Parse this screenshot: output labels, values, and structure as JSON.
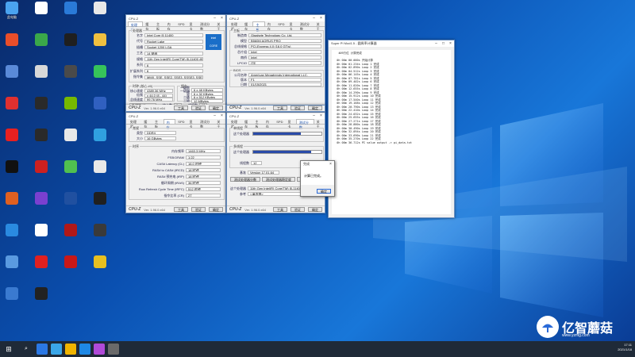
{
  "desktop": {
    "icons": [
      {
        "label": "此电脑",
        "color": "#4aa3f0"
      },
      {
        "label": "",
        "color": "#ffffff"
      },
      {
        "label": "",
        "color": "#2a7ad8"
      },
      {
        "label": "",
        "color": "#e8e8e8"
      },
      {
        "label": "",
        "color": "#e94e2a"
      },
      {
        "label": "",
        "color": "#3aa84a"
      },
      {
        "label": "",
        "color": "#1f1f1f"
      },
      {
        "label": "",
        "color": "#f0c040"
      },
      {
        "label": "",
        "color": "#5a8ad8"
      },
      {
        "label": "",
        "color": "#d8d8d8"
      },
      {
        "label": "",
        "color": "#4a4a4a"
      },
      {
        "label": "",
        "color": "#36c45a"
      },
      {
        "label": "",
        "color": "#e03030"
      },
      {
        "label": "",
        "color": "#2a2a2a"
      },
      {
        "label": "",
        "color": "#76b900"
      },
      {
        "label": "",
        "color": "#3060c0"
      },
      {
        "label": "",
        "color": "#e82020"
      },
      {
        "label": "",
        "color": "#2a2a2a"
      },
      {
        "label": "",
        "color": "#e8e8e8"
      },
      {
        "label": "",
        "color": "#30a0e0"
      },
      {
        "label": "",
        "color": "#111111"
      },
      {
        "label": "",
        "color": "#cc2020"
      },
      {
        "label": "",
        "color": "#50c050"
      },
      {
        "label": "",
        "color": "#e8e8e8"
      },
      {
        "label": "",
        "color": "#e06020"
      },
      {
        "label": "",
        "color": "#7a40d0"
      },
      {
        "label": "",
        "color": "#2050a0"
      },
      {
        "label": "",
        "color": "#202020"
      },
      {
        "label": "",
        "color": "#2a8ae0"
      },
      {
        "label": "",
        "color": "#ffffff"
      },
      {
        "label": "",
        "color": "#b01818"
      },
      {
        "label": "",
        "color": "#3a3a3a"
      },
      {
        "label": "",
        "color": "#5a9ae0"
      },
      {
        "label": "",
        "color": "#e02020"
      },
      {
        "label": "",
        "color": "#c81818"
      },
      {
        "label": "",
        "color": "#e8c020"
      },
      {
        "label": "",
        "color": "#3a7ad0"
      },
      {
        "label": "",
        "color": "#222222"
      }
    ]
  },
  "cpuz1": {
    "title": "CPU-Z",
    "tabs": [
      "处理器",
      "缓存",
      "主板",
      "内存",
      "SPD",
      "显卡",
      "测试分数",
      "关于"
    ],
    "group_title": "处理器",
    "fields": [
      {
        "k": "名字",
        "v": "Intel Core i5 11400"
      },
      {
        "k": "代号",
        "v": "Rocket Lake"
      },
      {
        "k": "插槽",
        "v": "Socket 1200 LGA"
      },
      {
        "k": "工艺",
        "v": "14 纳米"
      },
      {
        "k": "规格",
        "v": "11th Gen Intel(R) Core(TM) i5-11400 @ 2.60GHz"
      },
      {
        "k": "系列",
        "v": "6"
      },
      {
        "k": "扩展系列",
        "v": "6"
      },
      {
        "k": "指令集",
        "v": "MMX, SSE, SSE2, SSE3, SSSE3, SSE4.1, SSE4.2, EM64T, VT-x, AES, AVX, AVX2, AVX512F, FMA3, SHA"
      }
    ],
    "clock_title": "时钟 (核心 #0)",
    "clock": [
      {
        "k": "核心速度",
        "v": "4389.36 MHz"
      },
      {
        "k": "倍频",
        "v": "x 44.0 (8 - 44)"
      },
      {
        "k": "总线速度",
        "v": "99.76 MHz"
      }
    ],
    "cache_title": "缓存",
    "cache": [
      {
        "k": "一级数据",
        "v": "6 x 48 KBytes"
      },
      {
        "k": "一级指令",
        "v": "6 x 32 KBytes"
      },
      {
        "k": "二级",
        "v": "6 x 512 KBytes"
      },
      {
        "k": "三级",
        "v": "12 MBytes"
      }
    ],
    "selected": "处理器 #1",
    "cores_label": "核心数",
    "cores": "6",
    "threads_label": "线程数",
    "threads": "12",
    "brand": "CPU-Z",
    "version": "Ver. 1.96.0.x64",
    "btn_tools": "工具",
    "btn_validate": "验证",
    "btn_ok": "确定"
  },
  "cpuz2": {
    "title": "CPU-Z",
    "tabs": [
      "处理器",
      "缓存",
      "主板",
      "内存",
      "SPD",
      "显卡",
      "测试分数",
      "关于"
    ],
    "group_title": "主板",
    "fields": [
      {
        "k": "制造商",
        "v": "Gigabyte Technology Co. Ltd."
      },
      {
        "k": "模型",
        "v": "B560M AORUS PRO"
      },
      {
        "k": "总线规格",
        "v": "PCI-Express 4.0 (16.0 GT/s)"
      },
      {
        "k": "芯片组",
        "v": "Intel"
      },
      {
        "k": "南桥",
        "v": "Intel"
      },
      {
        "k": "LPCIO",
        "v": "ITE"
      }
    ],
    "bios_title": "BIOS",
    "bios": [
      {
        "k": "公司名称",
        "v": "American Megatrends International LLC."
      },
      {
        "k": "版本",
        "v": "F1"
      },
      {
        "k": "日期",
        "v": "01/15/2021"
      }
    ],
    "brand": "CPU-Z",
    "version": "Ver. 1.96.0.x64",
    "btn_tools": "工具",
    "btn_validate": "验证",
    "btn_ok": "确定"
  },
  "cpuz3": {
    "title": "CPU-Z",
    "tabs": [
      "处理器",
      "缓存",
      "主板",
      "内存",
      "SPD",
      "显卡",
      "测试分数",
      "关于"
    ],
    "group_title": "常规",
    "fields": [
      {
        "k": "类型",
        "v": "DDR4"
      },
      {
        "k": "大小",
        "v": "16 GBytes"
      }
    ],
    "timing_title": "时序",
    "timing": [
      {
        "k": "内存频率",
        "v": "1463.3 MHz"
      },
      {
        "k": "FSB:DRAM",
        "v": "1:22"
      },
      {
        "k": "CAS# Latency (CL)",
        "v": "16.0 时钟"
      },
      {
        "k": "RAS# to CAS# (tRCD)",
        "v": "18 时钟"
      },
      {
        "k": "RAS# 预充电 (tRP)",
        "v": "18 时钟"
      },
      {
        "k": "循环周期 (tRAS)",
        "v": "36 时钟"
      },
      {
        "k": "Row Refresh Cycle Time (tRFC)",
        "v": "512 时钟"
      },
      {
        "k": "指令比率 (CR)",
        "v": "2T"
      }
    ],
    "brand": "CPU-Z",
    "version": "Ver. 1.96.0.x64",
    "btn_tools": "工具",
    "btn_validate": "验证",
    "btn_ok": "确定"
  },
  "cpuz4": {
    "title": "CPU-Z",
    "tabs": [
      "处理器",
      "缓存",
      "主板",
      "内存",
      "SPD",
      "显卡",
      "测试分数",
      "关于"
    ],
    "single_title": "单线程",
    "single_label": "这个处理器",
    "single_value": 0.7,
    "multi_title": "多线程",
    "multi_label": "这个处理器",
    "multi_value": 0.85,
    "threads_label": "线程数",
    "threads_value": "12",
    "ref_label": "参考",
    "version_label": "基准",
    "version_value": "Version 17.01.64",
    "btn_bench": "测试处理器分数",
    "btn_stress": "测试处理器稳定度",
    "btn_submit": "提交和比较",
    "this_cpu_label": "这个处理器",
    "this_cpu_value": "11th Gen Intel(R) Core(TM) i5-11400",
    "ref_cpu_label": "参考",
    "ref_cpu_value": "<请选择>",
    "brand": "CPU-Z",
    "version": "Ver. 1.96.0.x64",
    "btn_tools": "工具",
    "btn_validate": "验证",
    "btn_ok": "确定"
  },
  "superpi": {
    "title": "Super PI Mod1.5 - 圆周率计算器",
    "lines": [
      "   409万位 计算完成",
      "",
      "  0h 00m 00.000s 开始计算",
      "  0h 00m 01.234s Loop 1 完成",
      "  0h 00m 02.890s Loop 2 完成",
      "  0h 00m 04.512s Loop 3 完成",
      "  0h 00m 06.145s Loop 4 完成",
      "  0h 00m 07.781s Loop 5 完成",
      "  0h 00m 09.402s Loop 6 完成",
      "  0h 00m 11.020s Loop 7 完成",
      "  0h 00m 12.655s Loop 8 完成",
      "  0h 00m 14.290s Loop 9 完成",
      "  0h 00m 15.912s Loop 10 完成",
      "  0h 00m 17.540s Loop 11 完成",
      "  0h 00m 19.168s Loop 12 完成",
      "  0h 00m 20.790s Loop 13 完成",
      "  0h 00m 22.410s Loop 14 完成",
      "  0h 00m 24.032s Loop 15 完成",
      "  0h 00m 25.655s Loop 16 完成",
      "  0h 00m 27.271s Loop 17 完成",
      "  0h 00m 28.880s Loop 18 完成",
      "  0h 00m 30.490s Loop 19 完成",
      "  0h 00m 32.094s Loop 20 完成",
      "  0h 00m 33.690s Loop 21 完成",
      "  0h 00m 35.270s Loop 22 完成",
      "  0h 00m 36.712s PI value output -> pi_data.txt"
    ]
  },
  "dialog": {
    "title": "完成",
    "message": "计算已完成。",
    "ok": "确定"
  },
  "taskbar": {
    "time": "17:11",
    "date": "2021/1/18",
    "icons": [
      "#2b78e4",
      "#3aa6e8",
      "#f0b400",
      "#1e88e5",
      "#b04ad8",
      "#6a6a6a"
    ]
  },
  "watermark": {
    "name": "亿智蘑菇",
    "url": "www.yzmg.com"
  }
}
